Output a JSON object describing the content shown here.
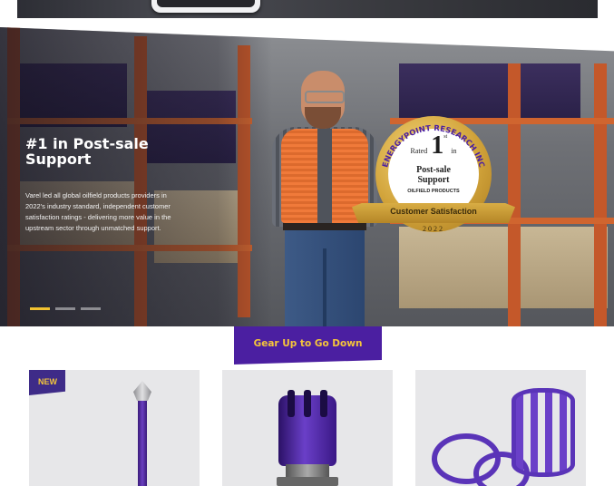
{
  "hero": {
    "title": "#1 in Post-sale Support",
    "description": "Varel led all global oilfield products providers in 2022's industry standard, independent customer satisfaction ratings - delivering more value in the upstream sector through unmatched support.",
    "slides": 3,
    "active_slide": 1
  },
  "badge": {
    "arc_text": "ENERGYPOINT RESEARCH INC",
    "rated": "Rated",
    "rank": "1",
    "rank_suffix": "st",
    "in": "in",
    "line1": "Post-sale",
    "line2": "Support",
    "category": "OILFIELD PRODUCTS",
    "ribbon": "Customer Satisfaction",
    "year": "2022"
  },
  "section": {
    "title": "Gear Up to Go Down"
  },
  "products": [
    {
      "badge": "NEW",
      "image": "purple-rod-tool"
    },
    {
      "badge": "",
      "image": "purple-drill-bit"
    },
    {
      "badge": "",
      "image": "purple-centralizers"
    }
  ],
  "colors": {
    "brand_purple": "#4b1fa1",
    "accent_gold": "#f6c63a"
  }
}
